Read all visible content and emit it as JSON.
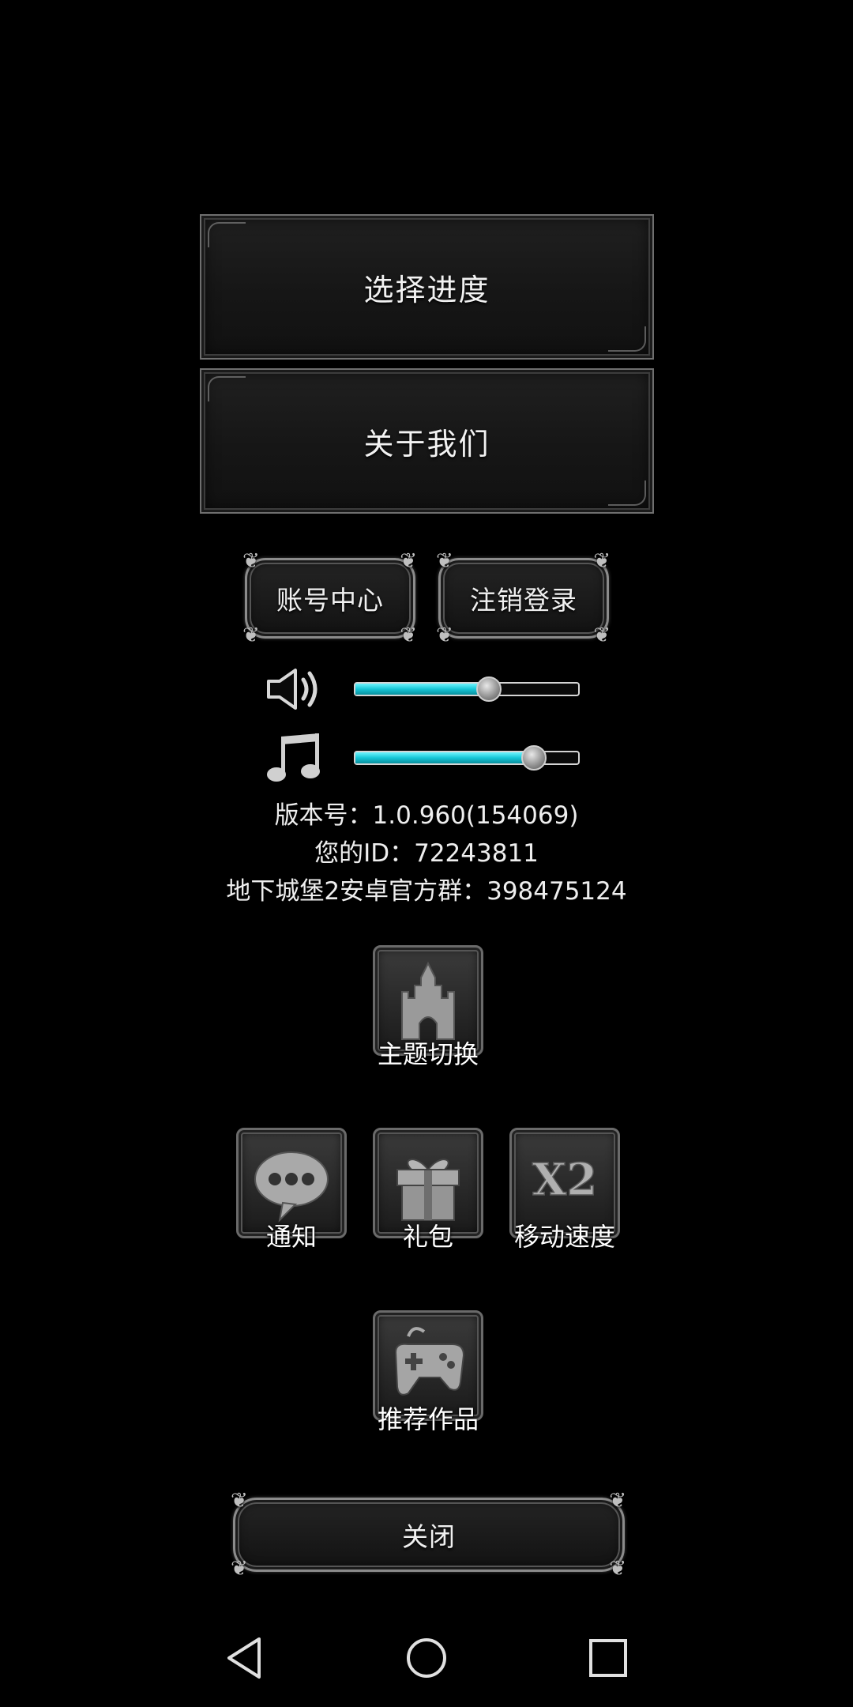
{
  "menu": {
    "select_progress": "选择进度",
    "about_us": "关于我们",
    "account_center": "账号中心",
    "logout": "注销登录"
  },
  "audio": {
    "sound_volume": 0.6,
    "music_volume": 0.8
  },
  "info": {
    "version": "版本号：1.0.960(154069)",
    "user_id": "您的ID：72243811",
    "group": "地下城堡2安卓官方群：398475124"
  },
  "tiles": {
    "theme_switch": "主题切换",
    "notice": "通知",
    "gift": "礼包",
    "move_speed": "移动速度",
    "move_speed_badge": "X2",
    "recommended": "推荐作品"
  },
  "close_label": "关闭",
  "icons": {
    "sound": "speaker-icon",
    "music": "music-note-icon",
    "theme": "castle-icon",
    "notice": "chat-bubble-icon",
    "gift": "gift-box-icon",
    "speed": "x2-speed-icon",
    "recommend": "gamepad-icon",
    "nav_back": "back-triangle-icon",
    "nav_home": "home-circle-icon",
    "nav_recent": "recent-square-icon"
  },
  "colors": {
    "slider_fill": "#16c6d6",
    "background": "#000000"
  }
}
